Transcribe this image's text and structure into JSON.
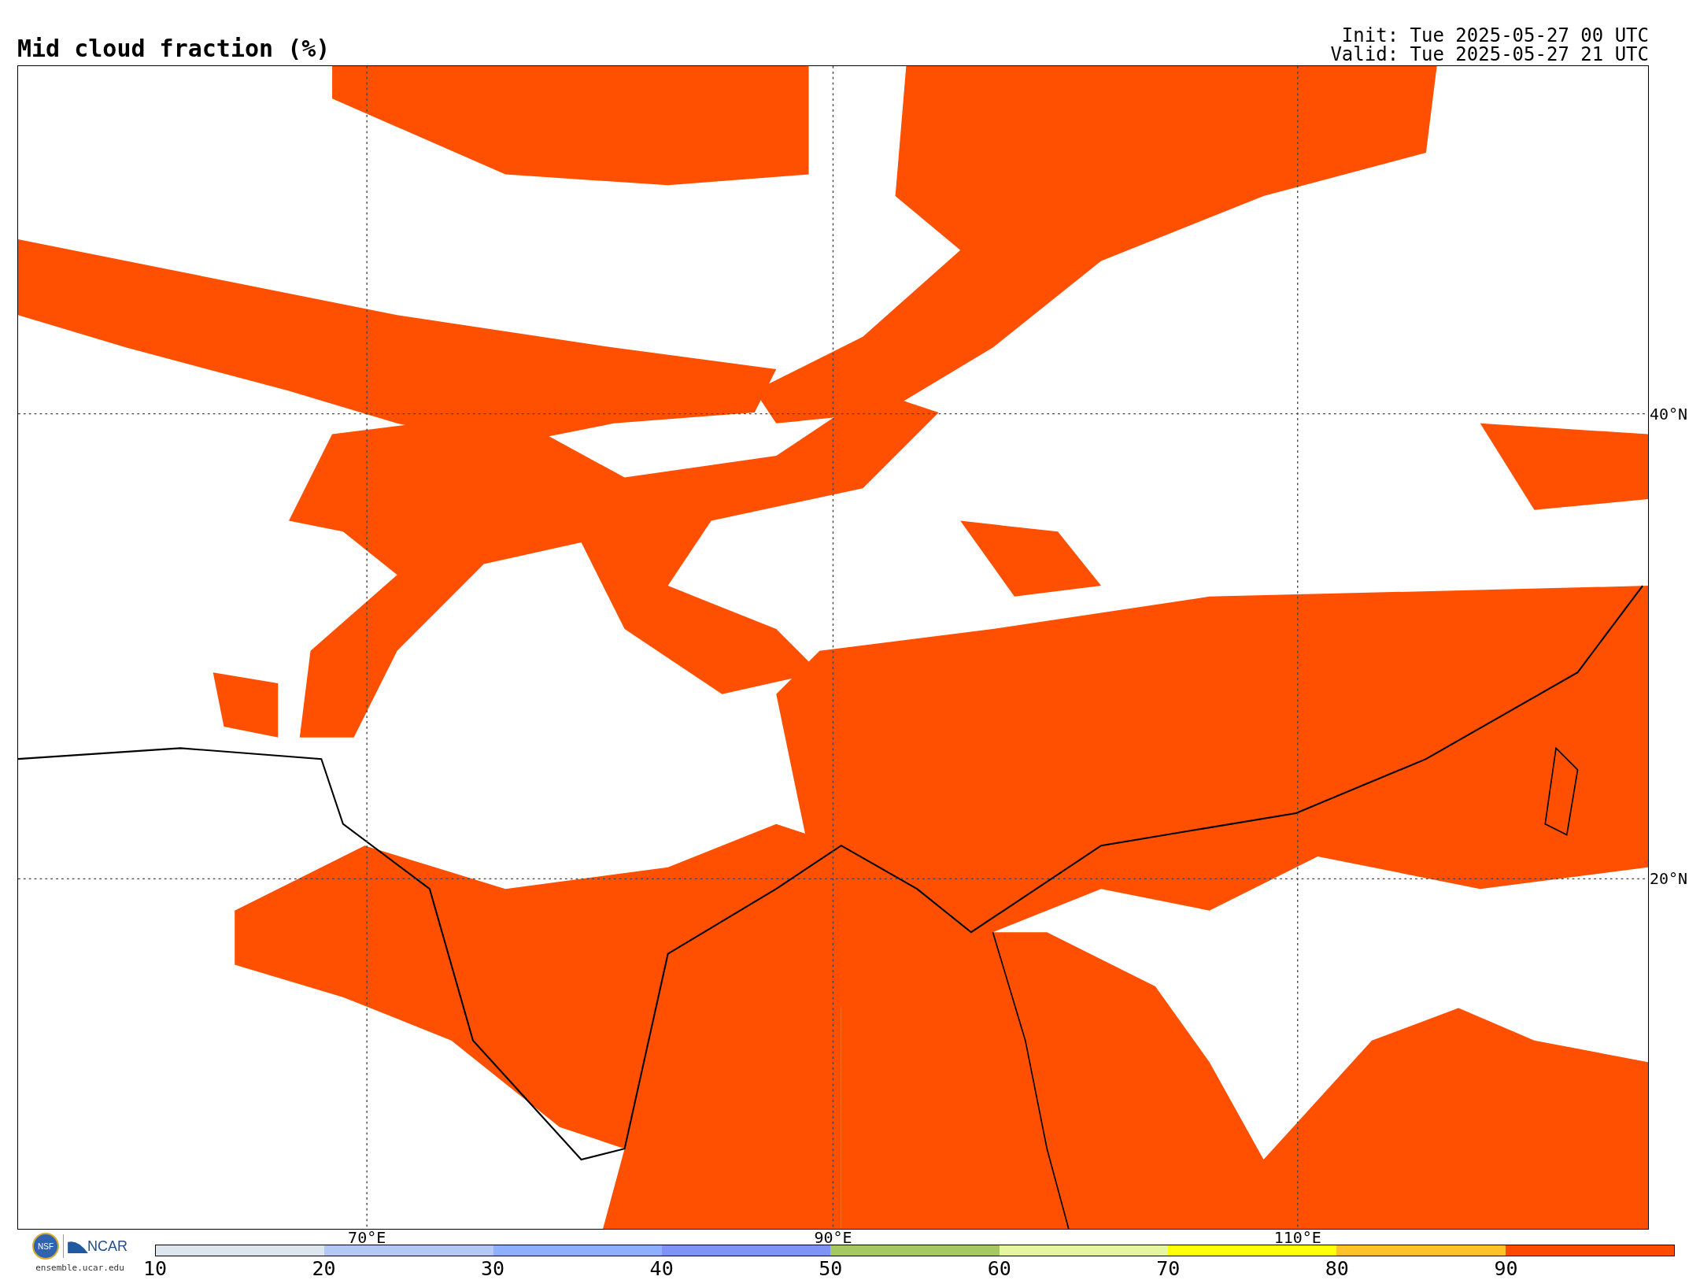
{
  "title": "Mid cloud fraction (%)",
  "init": "Init: Tue 2025-05-27 00 UTC",
  "valid": "Valid: Tue 2025-05-27 21 UTC",
  "map": {
    "lon_labels": [
      "70°E",
      "90°E",
      "110°E"
    ],
    "lat_labels": [
      "40°N",
      "20°N"
    ]
  },
  "logo": {
    "emblem": "NSF",
    "name": "NCAR",
    "url": "ensemble.ucar.edu"
  },
  "colorbar": {
    "segments": [
      {
        "color": "#dce6ec"
      },
      {
        "color": "#b4c8f5"
      },
      {
        "color": "#8cafff"
      },
      {
        "color": "#7d93f5"
      },
      {
        "color": "#a5c864"
      },
      {
        "color": "#e6f5a0"
      },
      {
        "color": "#ffff0a"
      },
      {
        "color": "#ffc328"
      },
      {
        "color": "#ff4b00"
      }
    ],
    "ticks": [
      "10",
      "20",
      "30",
      "40",
      "50",
      "60",
      "70",
      "80",
      "90"
    ]
  }
}
